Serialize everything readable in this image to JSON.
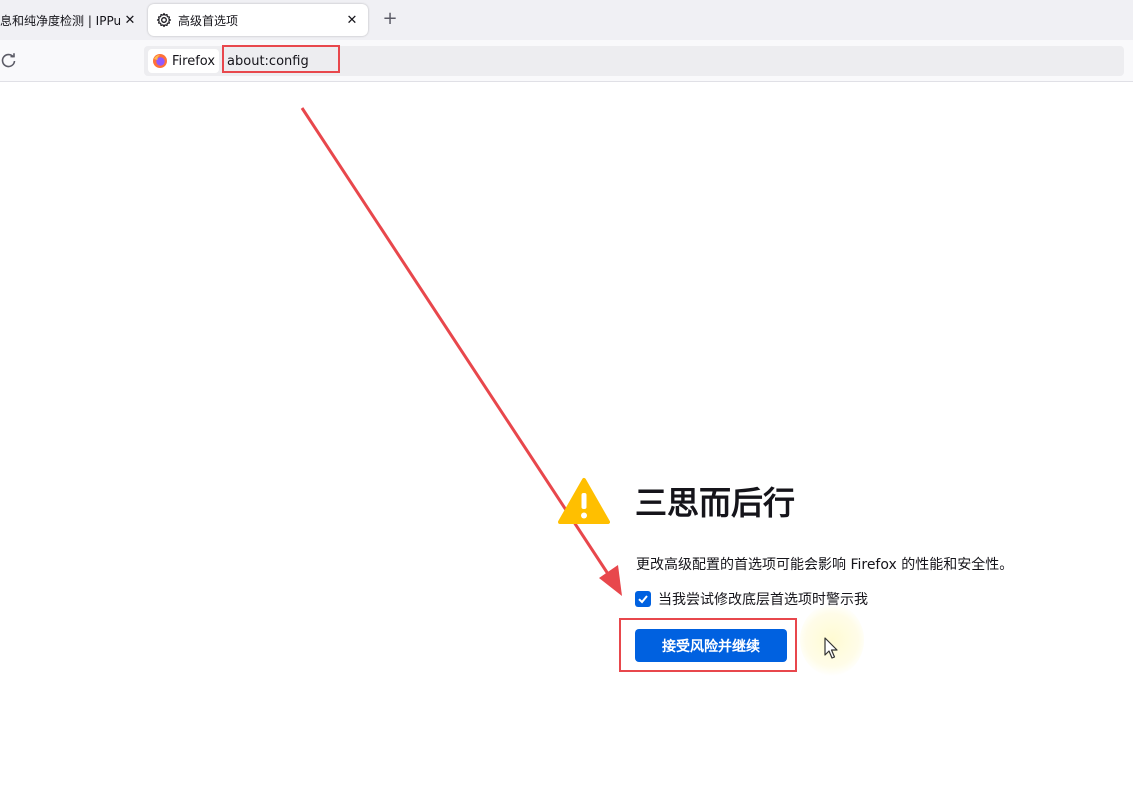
{
  "tabs": [
    {
      "title": "息和纯净度检测 | IPPu",
      "active": false,
      "close_glyph": "✕"
    },
    {
      "title": "高级首选项",
      "active": true,
      "close_glyph": "✕",
      "icon": "gear-icon"
    }
  ],
  "new_tab_glyph": "+",
  "navbar": {
    "identity_label": "Firefox",
    "url": "about:config"
  },
  "warning": {
    "title": "三思而后行",
    "description": "更改高级配置的首选项可能会影响 Firefox 的性能和安全性。",
    "checkbox_label": "当我尝试修改底层首选项时警示我",
    "checkbox_checked": true,
    "accept_button": "接受风险并继续"
  },
  "colors": {
    "accent": "#0061e0",
    "annotation": "#e8474c",
    "warning": "#ffbf00"
  }
}
